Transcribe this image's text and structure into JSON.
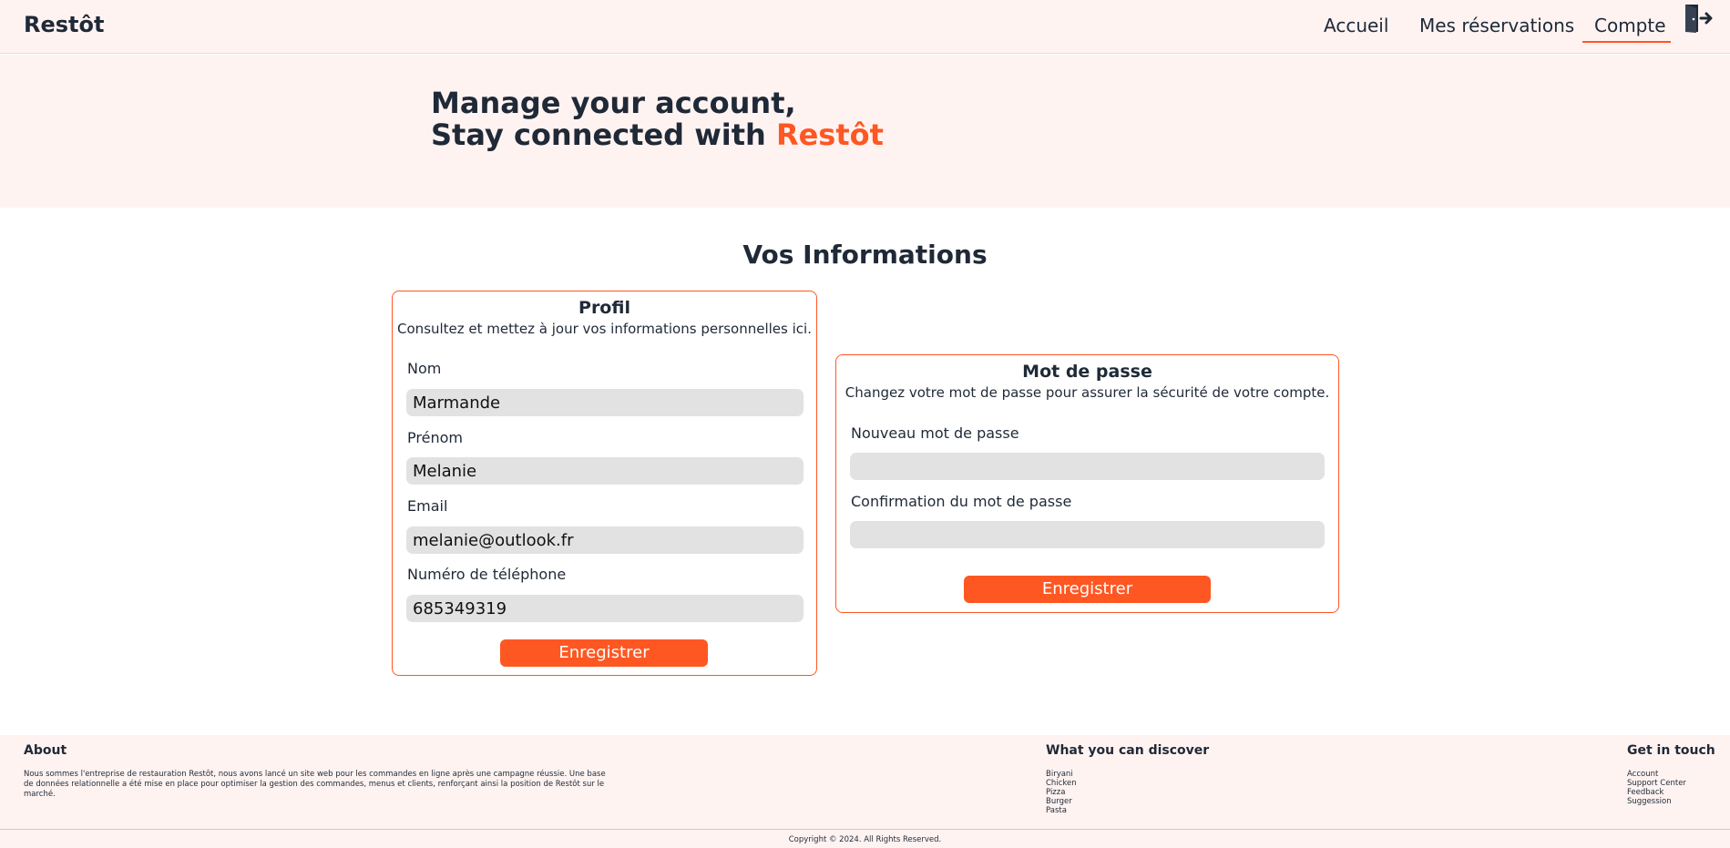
{
  "header": {
    "brand": "Restôt",
    "nav": [
      {
        "label": "Accueil"
      },
      {
        "label": "Mes réservations"
      },
      {
        "label": "Compte",
        "active": true
      }
    ],
    "logout_icon": "logout-door-icon"
  },
  "hero": {
    "line1": "Manage your account,",
    "line2_prefix": "Stay connected with ",
    "line2_accent": "Restôt"
  },
  "section_title": "Vos Informations",
  "profile": {
    "title": "Profil",
    "subtitle": "Consultez et mettez à jour vos informations personnelles ici.",
    "fields": [
      {
        "label": "Nom",
        "value": "Marmande"
      },
      {
        "label": "Prénom",
        "value": "Melanie"
      },
      {
        "label": "Email",
        "value": "melanie@outlook.fr"
      },
      {
        "label": "Numéro de téléphone",
        "value": "685349319"
      }
    ],
    "save_label": "Enregistrer"
  },
  "password": {
    "title": "Mot de passe",
    "subtitle": "Changez votre mot de passe pour assurer la sécurité de votre compte.",
    "fields": [
      {
        "label": "Nouveau mot de passe",
        "value": ""
      },
      {
        "label": "Confirmation du mot de passe",
        "value": ""
      }
    ],
    "save_label": "Enregistrer"
  },
  "footer": {
    "about_title": "About",
    "about_text": "Nous sommes l'entreprise de restauration Restôt, nous avons lancé un site web pour les commandes en ligne après une campagne réussie. Une base de données relationnelle a été mise en place pour optimiser la gestion des commandes, menus et clients, renforçant ainsi la position de Restôt sur le marché.",
    "discover_title": "What you can discover",
    "discover_items": [
      "Biryani",
      "Chicken",
      "Pizza",
      "Burger",
      "Pasta"
    ],
    "contact_title": "Get in touch",
    "contact_items": [
      "Account",
      "Support Center",
      "Feedback",
      "Suggession"
    ],
    "copyright": "Copyright © 2024. All Rights Reserved."
  },
  "colors": {
    "accent": "#ff5722",
    "background_tint": "#fff3f1",
    "text": "#1f2937",
    "input_bg": "#e2e2e2"
  }
}
